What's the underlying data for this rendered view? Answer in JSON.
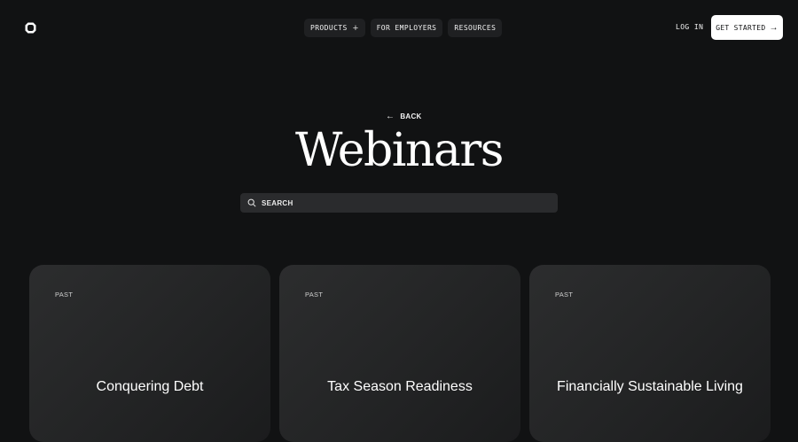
{
  "header": {
    "logo_icon": "rounded-square-logo-icon",
    "nav": [
      {
        "label": "PRODUCTS",
        "icon": "plus-icon"
      },
      {
        "label": "FOR EMPLOYERS"
      },
      {
        "label": "RESOURCES"
      }
    ],
    "login_label": "LOG IN",
    "cta_label": "GET STARTED",
    "cta_icon": "arrow-right-icon"
  },
  "hero": {
    "back_label": "BACK",
    "back_icon": "arrow-left-icon",
    "title": "Webinars"
  },
  "search": {
    "placeholder": "SEARCH",
    "value": "",
    "icon": "search-icon"
  },
  "cards": [
    {
      "status": "PAST",
      "title": "Conquering Debt"
    },
    {
      "status": "PAST",
      "title": "Tax Season Readiness"
    },
    {
      "status": "PAST",
      "title": "Financially Sustainable Living"
    }
  ],
  "colors": {
    "background": "#111213",
    "nav_button": "#1f2022",
    "search_bg": "#2a2b2d",
    "card_bg": "#262728",
    "cta_bg": "#ffffff",
    "text": "#ffffff"
  }
}
